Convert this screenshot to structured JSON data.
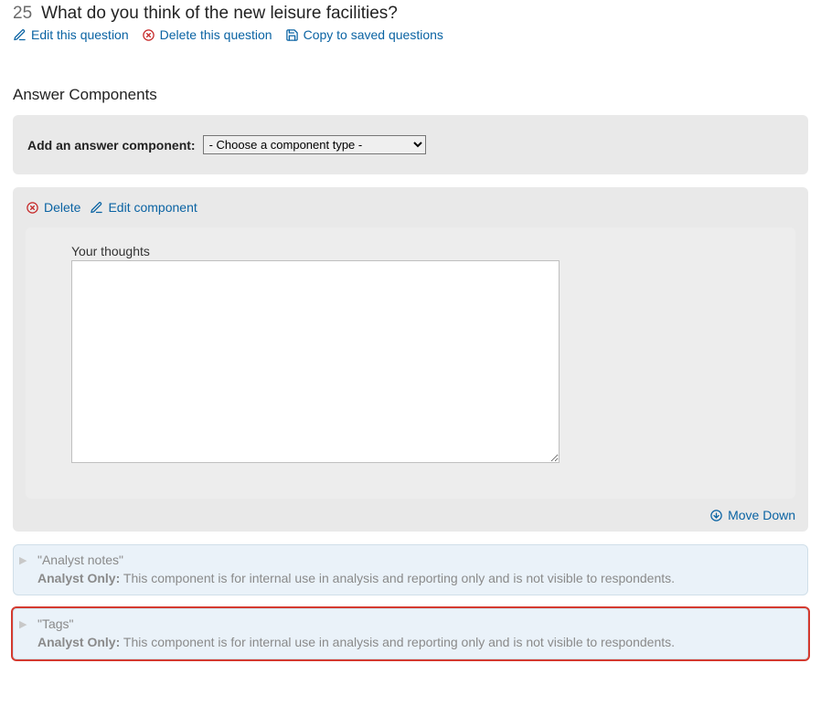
{
  "question": {
    "number": "25",
    "title": "What do you think of the new leisure facilities?"
  },
  "actions": {
    "edit_question": "Edit this question",
    "delete_question": "Delete this question",
    "copy_saved": "Copy to saved questions"
  },
  "sections": {
    "answer_components": "Answer Components"
  },
  "add_component": {
    "label": "Add an answer component:",
    "placeholder_option": "- Choose a component type -"
  },
  "component1": {
    "delete_label": "Delete",
    "edit_label": "Edit component",
    "field_label": "Your thoughts",
    "move_down": "Move Down"
  },
  "analyst_card1": {
    "title": "\"Analyst notes\"",
    "prefix": "Analyst Only:",
    "text": "This component is for internal use in analysis and reporting only and is not visible to respondents."
  },
  "analyst_card2": {
    "title": "\"Tags\"",
    "prefix": "Analyst Only:",
    "text": "This component is for internal use in analysis and reporting only and is not visible to respondents."
  }
}
